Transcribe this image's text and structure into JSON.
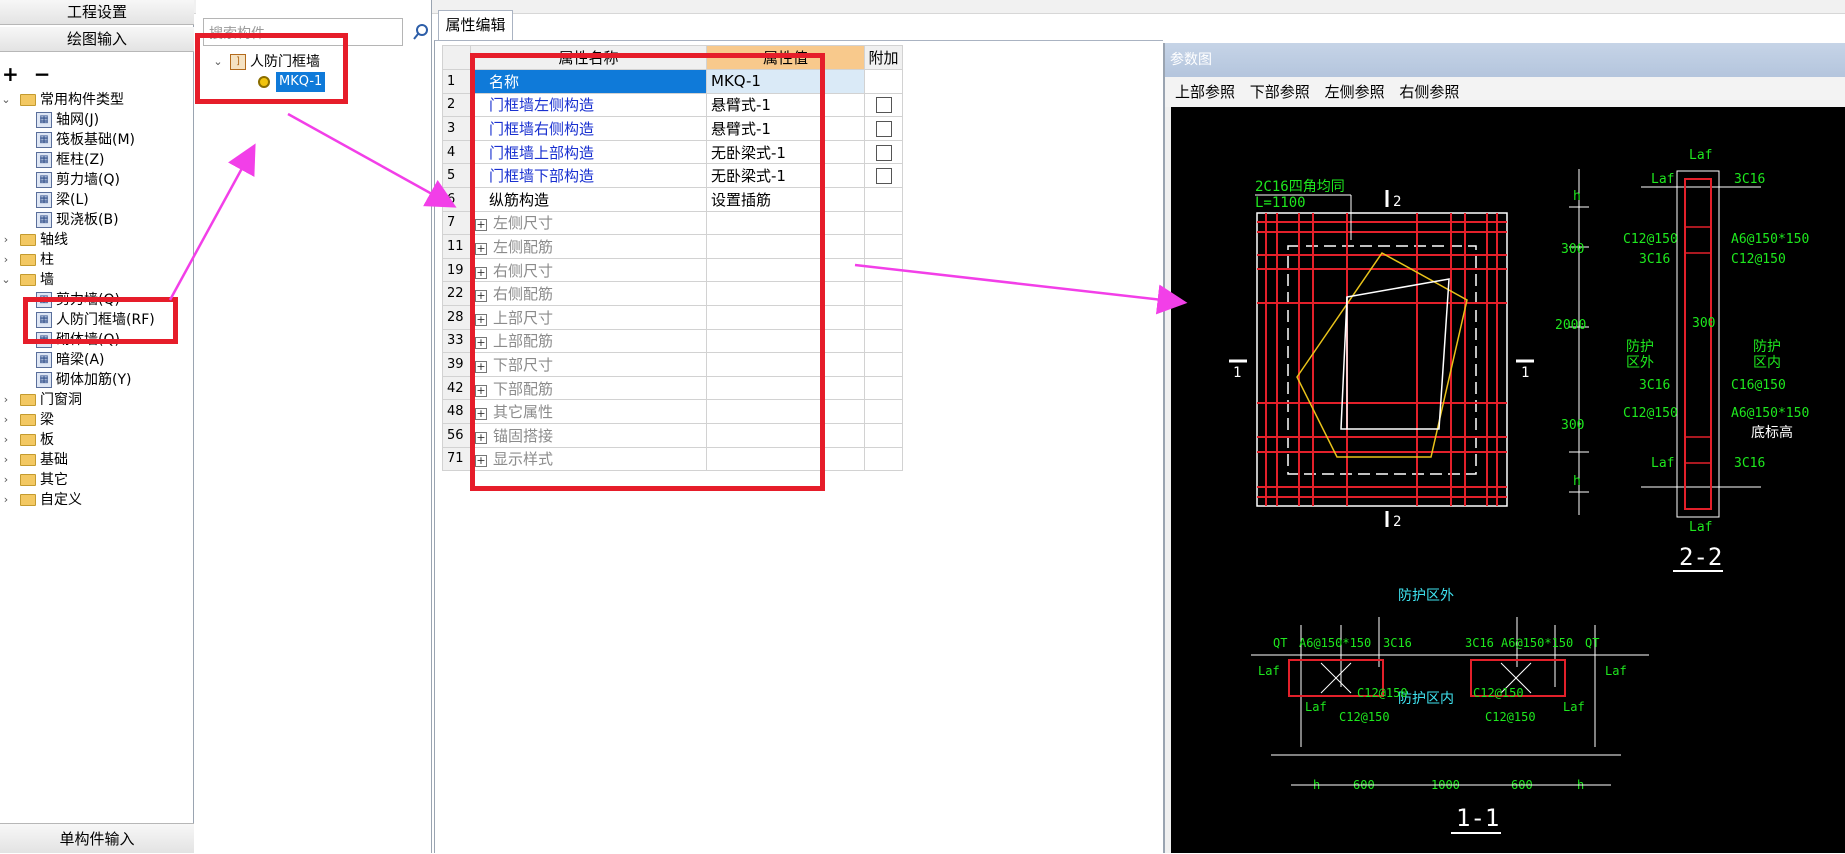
{
  "left_panel": {
    "btn_project_settings": "工程设置",
    "btn_drawing_input": "绘图输入",
    "btn_single_input": "单构件输入",
    "tree": [
      {
        "label": "常用构件类型",
        "level": 0,
        "kind": "folder",
        "expanded": true
      },
      {
        "label": "轴网(J)",
        "level": 1,
        "kind": "item"
      },
      {
        "label": "筏板基础(M)",
        "level": 1,
        "kind": "item"
      },
      {
        "label": "框柱(Z)",
        "level": 1,
        "kind": "item"
      },
      {
        "label": "剪力墙(Q)",
        "level": 1,
        "kind": "item"
      },
      {
        "label": "梁(L)",
        "level": 1,
        "kind": "item"
      },
      {
        "label": "现浇板(B)",
        "level": 1,
        "kind": "item"
      },
      {
        "label": "轴线",
        "level": 0,
        "kind": "folder"
      },
      {
        "label": "柱",
        "level": 0,
        "kind": "folder"
      },
      {
        "label": "墙",
        "level": 0,
        "kind": "folder",
        "expanded": true
      },
      {
        "label": "剪力墙(Q)",
        "level": 1,
        "kind": "item"
      },
      {
        "label": "人防门框墙(RF)",
        "level": 1,
        "kind": "item",
        "highlight": true
      },
      {
        "label": "砌体墙(Q)",
        "level": 1,
        "kind": "item"
      },
      {
        "label": "暗梁(A)",
        "level": 1,
        "kind": "item"
      },
      {
        "label": "砌体加筋(Y)",
        "level": 1,
        "kind": "item"
      },
      {
        "label": "门窗洞",
        "level": 0,
        "kind": "folder"
      },
      {
        "label": "梁",
        "level": 0,
        "kind": "folder"
      },
      {
        "label": "板",
        "level": 0,
        "kind": "folder"
      },
      {
        "label": "基础",
        "level": 0,
        "kind": "folder"
      },
      {
        "label": "其它",
        "level": 0,
        "kind": "folder"
      },
      {
        "label": "自定义",
        "level": 0,
        "kind": "folder"
      }
    ]
  },
  "mid_panel": {
    "search_placeholder": "搜索构件...",
    "tree_root": "人防门框墙",
    "tree_child": "MKQ-1"
  },
  "prop_editor": {
    "tab_label": "属性编辑",
    "col_name": "属性名称",
    "col_value": "属性值",
    "col_add": "附加",
    "rows": [
      {
        "num": "1",
        "name": "名称",
        "value": "MKQ-1",
        "style": "selected",
        "checkbox": false
      },
      {
        "num": "2",
        "name": "门框墙左侧构造",
        "value": "悬臂式-1",
        "style": "blue",
        "checkbox": true
      },
      {
        "num": "3",
        "name": "门框墙右侧构造",
        "value": "悬臂式-1",
        "style": "blue",
        "checkbox": true
      },
      {
        "num": "4",
        "name": "门框墙上部构造",
        "value": "无卧梁式-1",
        "style": "blue",
        "checkbox": true
      },
      {
        "num": "5",
        "name": "门框墙下部构造",
        "value": "无卧梁式-1",
        "style": "blue",
        "checkbox": true
      },
      {
        "num": "6",
        "name": "纵筋构造",
        "value": "设置插筋",
        "style": "black",
        "checkbox": false
      },
      {
        "num": "7",
        "name": "左侧尺寸",
        "value": "",
        "style": "group",
        "checkbox": false
      },
      {
        "num": "11",
        "name": "左侧配筋",
        "value": "",
        "style": "group",
        "checkbox": false
      },
      {
        "num": "19",
        "name": "右侧尺寸",
        "value": "",
        "style": "group",
        "checkbox": false
      },
      {
        "num": "22",
        "name": "右侧配筋",
        "value": "",
        "style": "group",
        "checkbox": false
      },
      {
        "num": "28",
        "name": "上部尺寸",
        "value": "",
        "style": "group",
        "checkbox": false
      },
      {
        "num": "33",
        "name": "上部配筋",
        "value": "",
        "style": "group",
        "checkbox": false
      },
      {
        "num": "39",
        "name": "下部尺寸",
        "value": "",
        "style": "group",
        "checkbox": false
      },
      {
        "num": "42",
        "name": "下部配筋",
        "value": "",
        "style": "group",
        "checkbox": false
      },
      {
        "num": "48",
        "name": "其它属性",
        "value": "",
        "style": "group",
        "checkbox": false
      },
      {
        "num": "56",
        "name": "锚固搭接",
        "value": "",
        "style": "group",
        "checkbox": false
      },
      {
        "num": "71",
        "name": "显示样式",
        "value": "",
        "style": "group",
        "checkbox": false
      }
    ]
  },
  "param_window": {
    "title": "参数图",
    "refs": [
      "上部参照",
      "下部参照",
      "左侧参照",
      "右侧参照"
    ]
  },
  "drawing_text": {
    "t_2c16_corner": "2C16四角均同",
    "t_l1100": "L=1100",
    "t_sec2": "2",
    "t_sec1": "1",
    "t_laf": "Laf",
    "t_3c16": "3C16",
    "t_c12_150": "C12@150",
    "t_a6": "A6@150*150",
    "t_h": "h",
    "t_300": "300",
    "t_2000": "2000",
    "t_protect_out": "防护\n区外",
    "t_protect_in": "防护\n区内",
    "t_c16_150": "C16@150",
    "t_bottom_elev": "底标高",
    "t_title_22": "2-2",
    "t_protect_out_h": "防护区外",
    "t_protect_in_h": "防护区内",
    "t_qt": "QT",
    "t_600": "600",
    "t_1000": "1000",
    "t_title_11": "1-1"
  },
  "colors": {
    "highlight_red": "#e61d2a",
    "arrow_magenta": "#f23fe8",
    "selection_blue": "#0f7ad9",
    "link_blue": "#1a31d0",
    "cad_green": "#1ee81e",
    "cad_cyan": "#3fe3f0",
    "cad_red": "#e3202a",
    "cad_yellow": "#e8c21a"
  }
}
